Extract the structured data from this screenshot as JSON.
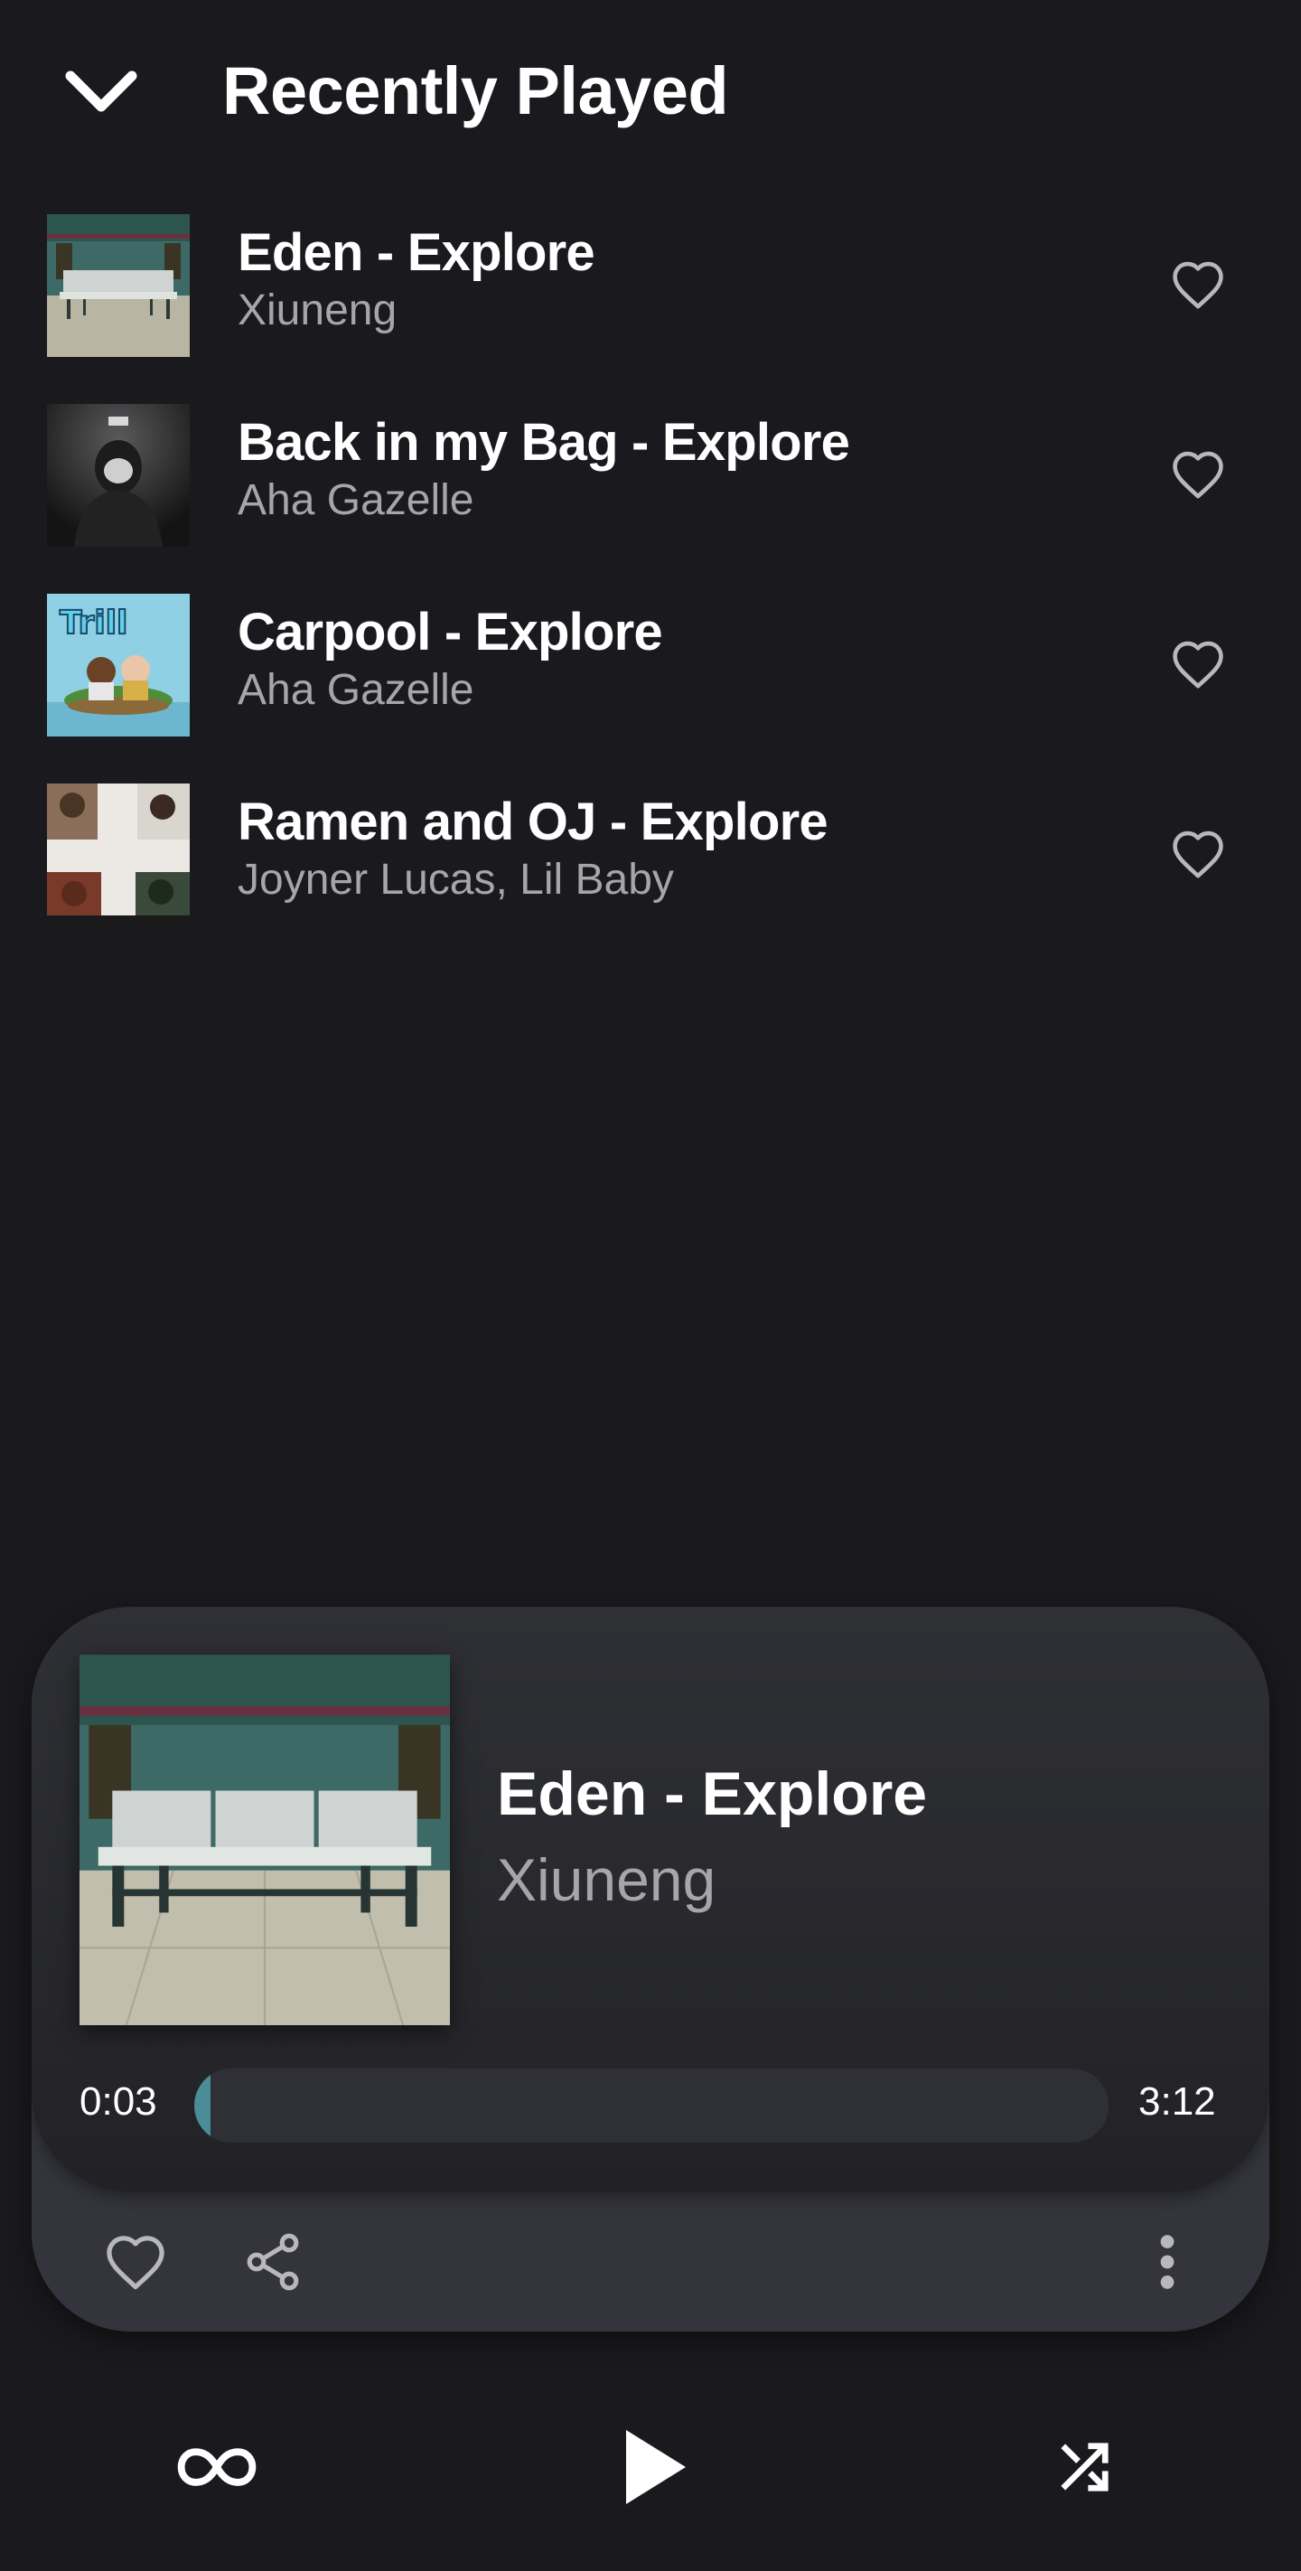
{
  "header": {
    "title": "Recently Played",
    "back_icon": "chevron-down-icon"
  },
  "tracks": [
    {
      "title": "Eden - Explore",
      "artist": "Xiuneng",
      "liked": false,
      "art": "subway-bench"
    },
    {
      "title": "Back in my Bag - Explore",
      "artist": "Aha Gazelle",
      "liked": false,
      "art": "hooded-figure"
    },
    {
      "title": "Carpool - Explore",
      "artist": "Aha Gazelle",
      "liked": false,
      "art": "cartoon-island"
    },
    {
      "title": "Ramen and OJ - Explore",
      "artist": "Joyner Lucas, Lil Baby",
      "liked": false,
      "art": "collage"
    }
  ],
  "player": {
    "title": "Eden - Explore",
    "artist": "Xiuneng",
    "current_time": "0:03",
    "total_time": "3:12",
    "progress": 0.016,
    "accent_color": "#4a8c97"
  },
  "card_actions": [
    {
      "name": "heart-icon",
      "label": "like"
    },
    {
      "name": "share-icon",
      "label": "share"
    },
    {
      "name": "more-vertical-icon",
      "label": "more"
    }
  ],
  "controls": [
    {
      "name": "repeat-infinity-icon"
    },
    {
      "name": "play-icon"
    },
    {
      "name": "shuffle-icon"
    }
  ],
  "colors": {
    "background": "#1a1a1e",
    "card": "#34353c",
    "secondary_text": "#a5a5aa"
  }
}
